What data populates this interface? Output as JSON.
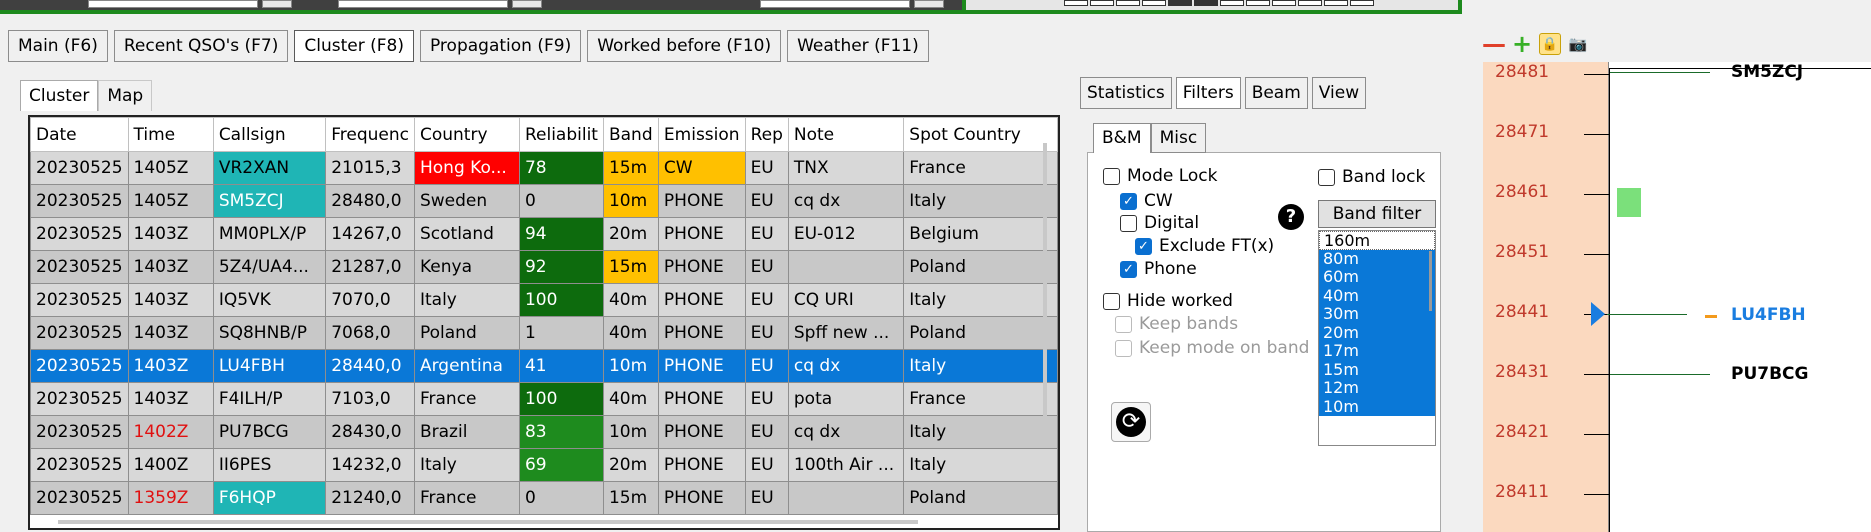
{
  "main_tabs": [
    "Main (F6)",
    "Recent QSO's (F7)",
    "Cluster (F8)",
    "Propagation (F9)",
    "Worked before (F10)",
    "Weather (F11)"
  ],
  "sub_tabs": [
    "Cluster",
    "Map"
  ],
  "columns": [
    "Date",
    "Time",
    "Callsign",
    "Frequenc",
    "Country",
    "Reliabilit",
    "Band",
    "Emission",
    "Rep",
    "Note",
    "Spot Country"
  ],
  "rows": [
    {
      "date": "20230525",
      "time": "1405Z",
      "callsign": "VR2XAN",
      "freq": "21015,3",
      "country": "Hong Ko...",
      "rel": "78",
      "band": "15m",
      "emission": "CW",
      "rep": "EU",
      "note": "TNX",
      "spot_country": "France"
    },
    {
      "date": "20230525",
      "time": "1405Z",
      "callsign": "SM5ZCJ",
      "freq": "28480,0",
      "country": "Sweden",
      "rel": "0",
      "band": "10m",
      "emission": "PHONE",
      "rep": "EU",
      "note": "cq dx",
      "spot_country": "Italy"
    },
    {
      "date": "20230525",
      "time": "1403Z",
      "callsign": "MM0PLX/P",
      "freq": "14267,0",
      "country": "Scotland",
      "rel": "94",
      "band": "20m",
      "emission": "PHONE",
      "rep": "EU",
      "note": "EU-012",
      "spot_country": "Belgium"
    },
    {
      "date": "20230525",
      "time": "1403Z",
      "callsign": "5Z4/UA4...",
      "freq": "21287,0",
      "country": "Kenya",
      "rel": "92",
      "band": "15m",
      "emission": "PHONE",
      "rep": "EU",
      "note": "",
      "spot_country": "Poland"
    },
    {
      "date": "20230525",
      "time": "1403Z",
      "callsign": "IQ5VK",
      "freq": "7070,0",
      "country": "Italy",
      "rel": "100",
      "band": "40m",
      "emission": "PHONE",
      "rep": "EU",
      "note": "CQ URI",
      "spot_country": "Italy"
    },
    {
      "date": "20230525",
      "time": "1403Z",
      "callsign": "SQ8HNB/P",
      "freq": "7068,0",
      "country": "Poland",
      "rel": "1",
      "band": "40m",
      "emission": "PHONE",
      "rep": "EU",
      "note": "Spff new ...",
      "spot_country": "Poland"
    },
    {
      "date": "20230525",
      "time": "1403Z",
      "callsign": "LU4FBH",
      "freq": "28440,0",
      "country": "Argentina",
      "rel": "41",
      "band": "10m",
      "emission": "PHONE",
      "rep": "EU",
      "note": "cq dx",
      "spot_country": "Italy"
    },
    {
      "date": "20230525",
      "time": "1403Z",
      "callsign": "F4ILH/P",
      "freq": "7103,0",
      "country": "France",
      "rel": "100",
      "band": "40m",
      "emission": "PHONE",
      "rep": "EU",
      "note": "pota",
      "spot_country": "France"
    },
    {
      "date": "20230525",
      "time": "1402Z",
      "callsign": "PU7BCG",
      "freq": "28430,0",
      "country": "Brazil",
      "rel": "83",
      "band": "10m",
      "emission": "PHONE",
      "rep": "EU",
      "note": "cq dx",
      "spot_country": "Italy"
    },
    {
      "date": "20230525",
      "time": "1400Z",
      "callsign": "II6PES",
      "freq": "14232,0",
      "country": "Italy",
      "rel": "69",
      "band": "20m",
      "emission": "PHONE",
      "rep": "EU",
      "note": "100th Air ...",
      "spot_country": "Italy"
    },
    {
      "date": "20230525",
      "time": "1359Z",
      "callsign": "F6HQP",
      "freq": "21240,0",
      "country": "France",
      "rel": "0",
      "band": "15m",
      "emission": "PHONE",
      "rep": "EU",
      "note": "",
      "spot_country": "Poland"
    }
  ],
  "right_tabs": [
    "Statistics",
    "Filters",
    "Beam",
    "View"
  ],
  "filter_tabs": [
    "B&M",
    "Misc"
  ],
  "filters": {
    "mode_lock": "Mode Lock",
    "cw": "CW",
    "digital": "Digital",
    "exclude_ft": "Exclude FT(x)",
    "phone": "Phone",
    "hide_worked": "Hide worked",
    "keep_bands": "Keep bands",
    "keep_mode": "Keep mode on band",
    "band_lock": "Band lock",
    "band_filter": "Band filter",
    "help": "?",
    "refresh": "⟳",
    "bands": [
      "160m",
      "80m",
      "60m",
      "40m",
      "30m",
      "20m",
      "17m",
      "15m",
      "12m",
      "10m"
    ]
  },
  "bandmap": {
    "tools": {
      "minus": "—",
      "plus": "+",
      "lock": "🔒",
      "camera": "📷"
    },
    "freqs": [
      "28481",
      "28471",
      "28461",
      "28451",
      "28441",
      "28431",
      "28421",
      "28411"
    ],
    "spots": [
      {
        "call": "SM5ZCJ"
      },
      {
        "call": "LU4FBH"
      },
      {
        "call": "PU7BCG"
      }
    ]
  },
  "colors": {
    "selected": "#0a78d7",
    "green": "#0d6b0d",
    "yellow": "#ffc000",
    "red": "#ff0000",
    "teal": "#1fb5b5",
    "freq_bg": "#fbd9bf"
  }
}
